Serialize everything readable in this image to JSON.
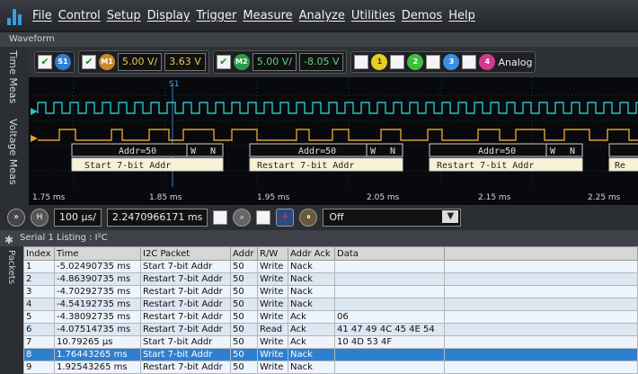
{
  "menu": [
    "File",
    "Control",
    "Setup",
    "Display",
    "Trigger",
    "Measure",
    "Analyze",
    "Utilities",
    "Demos",
    "Help"
  ],
  "waveform_panel": {
    "title": "Waveform"
  },
  "side_tabs": [
    "Time Meas",
    "Voltage Meas"
  ],
  "toolbar": {
    "ch1_label": "S1",
    "m1_label": "M1",
    "m1_scale": "5.00 V/",
    "m1_offset": "3.63 V",
    "m2_label": "M2",
    "m2_scale": "5.00 V/",
    "m2_offset": "-8.05 V",
    "channels": [
      "1",
      "2",
      "3",
      "4"
    ],
    "analog_label": "Analog"
  },
  "waveform": {
    "marker": "S1",
    "ticks": [
      "1.75 ms",
      "1.85 ms",
      "1.95 ms",
      "2.05 ms",
      "2.15 ms",
      "2.25 ms"
    ],
    "decode_addr": [
      "Addr=50",
      "Addr=50",
      "Addr=50"
    ],
    "decode_rw": [
      "W",
      "W",
      "W"
    ],
    "decode_ack": [
      "N",
      "N",
      "N"
    ],
    "decode_start": [
      "Start 7-bit Addr",
      "Restart 7-bit Addr",
      "Restart 7-bit Addr",
      "Re"
    ]
  },
  "timebar": {
    "h_label": "H",
    "scale": "100 µs/",
    "position": "2.2470966171 ms",
    "zoom_mode": "Off"
  },
  "listing": {
    "title": "Serial 1 Listing : I²C",
    "side_tab": "Packets",
    "columns": [
      "Index",
      "Time",
      "I2C Packet",
      "Addr",
      "R/W",
      "Addr Ack",
      "Data"
    ],
    "rows": [
      [
        "1",
        "-5.02490735 ms",
        "Start 7-bit Addr",
        "50",
        "Write",
        "Nack",
        ""
      ],
      [
        "2",
        "-4.86390735 ms",
        "Restart 7-bit Addr",
        "50",
        "Write",
        "Nack",
        ""
      ],
      [
        "3",
        "-4.70292735 ms",
        "Restart 7-bit Addr",
        "50",
        "Write",
        "Nack",
        ""
      ],
      [
        "4",
        "-4.54192735 ms",
        "Restart 7-bit Addr",
        "50",
        "Write",
        "Nack",
        ""
      ],
      [
        "5",
        "-4.38092735 ms",
        "Restart 7-bit Addr",
        "50",
        "Write",
        "Ack",
        "06"
      ],
      [
        "6",
        "-4.07514735 ms",
        "Restart 7-bit Addr",
        "50",
        "Read",
        "Ack",
        "41 47 49 4C 45 4E 54"
      ],
      [
        "7",
        "10.79265 µs",
        "Start 7-bit Addr",
        "50",
        "Write",
        "Ack",
        "10 4D 53 4F"
      ],
      [
        "8",
        "1.76443265 ms",
        "Start 7-bit Addr",
        "50",
        "Write",
        "Nack",
        ""
      ],
      [
        "9",
        "1.92543265 ms",
        "Restart 7-bit Addr",
        "50",
        "Write",
        "Nack",
        ""
      ]
    ],
    "selected_index": 7
  },
  "colors": {
    "ch1": "#2f7fd0",
    "m1": "#c8892a",
    "m2": "#2f9a4a",
    "c1": "#e3d021",
    "c2": "#3fbf3a",
    "c3": "#3a8fe0",
    "c4": "#d23a8e",
    "trace_top": "#2bc2c8",
    "trace_bottom": "#e0a030"
  }
}
